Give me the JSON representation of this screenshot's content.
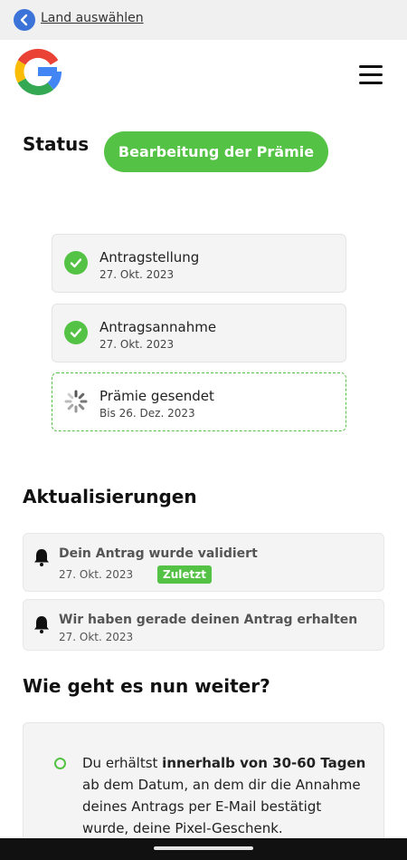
{
  "topbar": {
    "back_label": "Land auswählen"
  },
  "status": {
    "label": "Status",
    "pill": "Bearbeitung der Prämie"
  },
  "steps": [
    {
      "title": "Antragstellung",
      "date": "27. Okt. 2023",
      "state": "done"
    },
    {
      "title": "Antragsannahme",
      "date": "27. Okt. 2023",
      "state": "done"
    },
    {
      "title": "Prämie gesendet",
      "date": "Bis 26. Dez. 2023",
      "state": "pending"
    }
  ],
  "updates": {
    "heading": "Aktualisierungen",
    "items": [
      {
        "title": "Dein Antrag wurde validiert",
        "date": "27. Okt. 2023",
        "badge": "Zuletzt"
      },
      {
        "title": "Wir haben gerade deinen Antrag erhalten",
        "date": "27. Okt. 2023"
      }
    ]
  },
  "next": {
    "heading": "Wie geht es nun weiter?",
    "text_pre": "Du erhältst ",
    "text_bold": "innerhalb von 30-60 Tagen",
    "text_post": " ab dem Datum, an dem dir die Annahme deines Antrags per E-Mail bestätigt wurde, deine Pixel-Geschenk."
  },
  "colors": {
    "accent_green": "#54c244",
    "back_blue": "#3b73d9"
  },
  "icons": [
    "back-arrow-icon",
    "google-logo",
    "hamburger-menu-icon",
    "check-icon",
    "spinner-icon",
    "bell-icon"
  ]
}
